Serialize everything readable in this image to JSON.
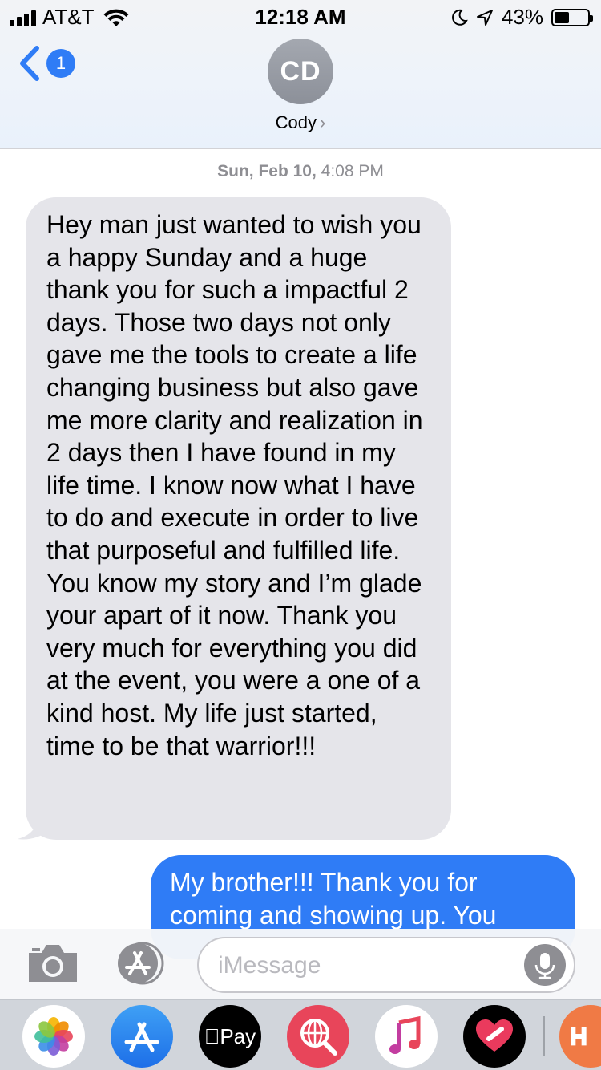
{
  "status_bar": {
    "carrier": "AT&T",
    "time": "12:18 AM",
    "battery_percent": "43%"
  },
  "header": {
    "back_badge": "1",
    "avatar_initials": "CD",
    "contact_name": "Cody",
    "contact_chevron": "›"
  },
  "conversation": {
    "date_day": "Sun, Feb 10,",
    "date_time": "4:08 PM",
    "incoming_message": "Hey man just wanted to wish you a happy Sunday and a huge thank you for such a impactful 2 days. Those two days not only gave me the tools to create a life changing business but also gave me more clarity and realization in 2 days then I have found in my life time. I know now what I have to do and execute in order to live that purposeful and fulfilled life. You know my story and I’m glade your apart of it now. Thank you very much for everything you did at the event, you were a one of a kind host. My life just started, time to be that warrior!!!",
    "outgoing_message": "My brother!!! Thank you for coming and showing up. You"
  },
  "composer": {
    "placeholder": "iMessage"
  },
  "app_drawer": {
    "pay_label": "Pay"
  },
  "colors": {
    "accent_blue": "#2f7cf6",
    "incoming_bubble": "#e5e5ea",
    "outgoing_bubble": "#2f7cf6"
  },
  "icons": [
    "signal-icon",
    "wifi-icon",
    "moon-icon",
    "location-icon",
    "battery-icon",
    "back-chevron-icon",
    "camera-icon",
    "app-store-icon",
    "microphone-icon",
    "photos-icon",
    "apple-pay-icon",
    "search-globe-icon",
    "music-icon",
    "heart-icon"
  ]
}
